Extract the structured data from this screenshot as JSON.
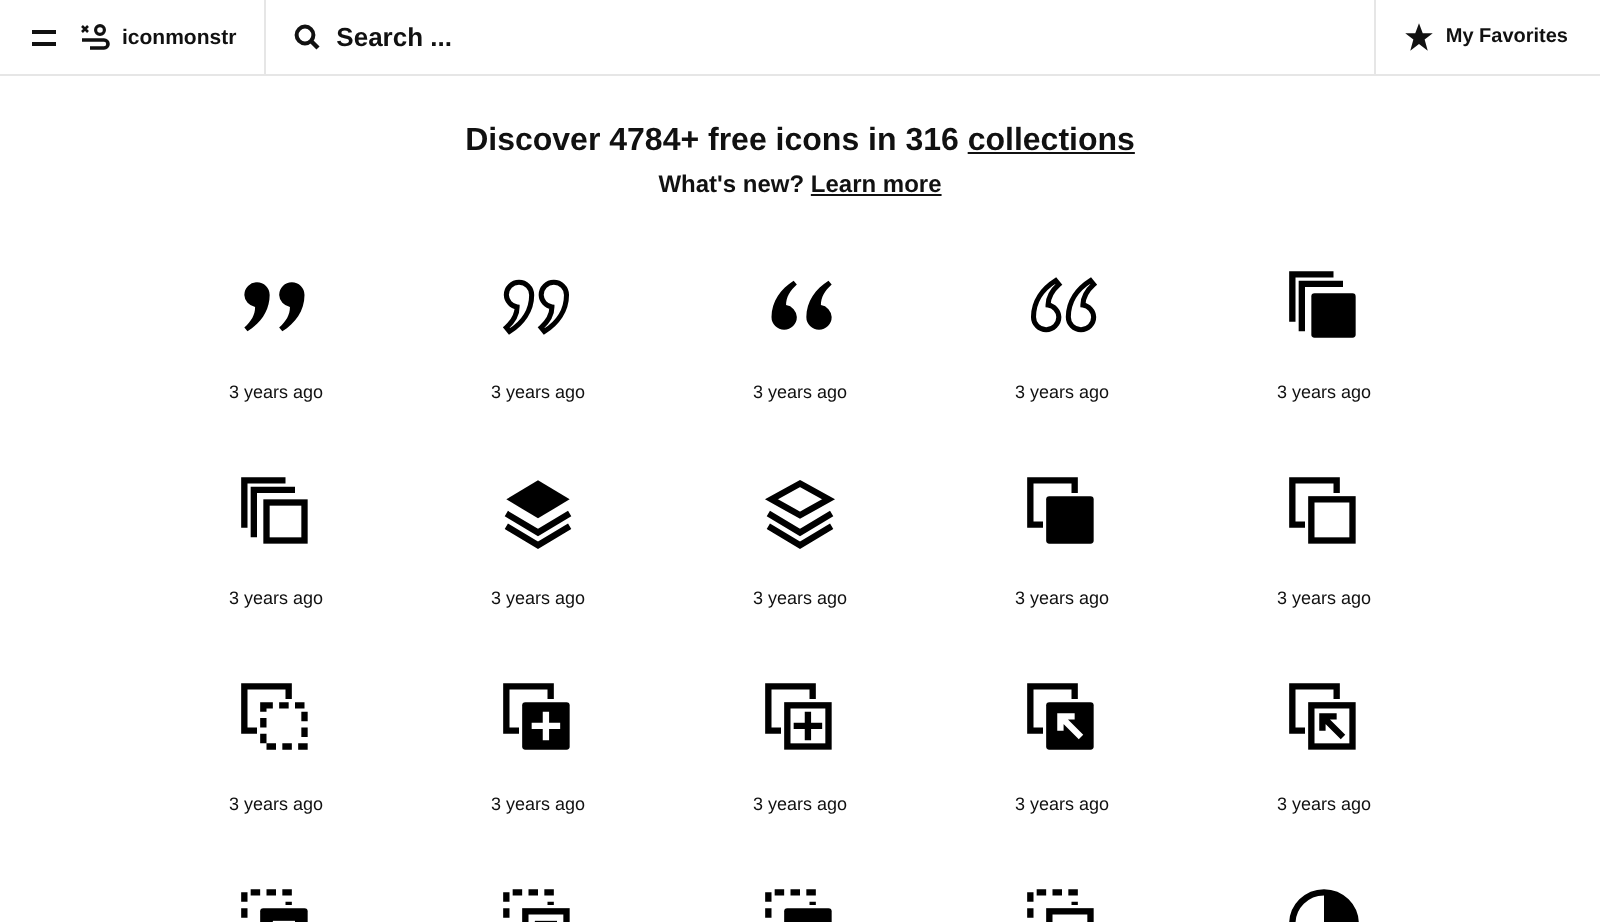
{
  "header": {
    "logo_text": "iconmonstr",
    "search": {
      "placeholder": "Search ..."
    },
    "favorites": "My Favorites"
  },
  "hero": {
    "title": "Discover 4784+ free icons in 316",
    "title_link": "collections",
    "subtitle": "What's new?",
    "subtitle_link": "Learn more"
  },
  "icons": [
    {
      "kind": "quote-close-filled",
      "time": "3 years ago"
    },
    {
      "kind": "quote-close-outline",
      "time": "3 years ago"
    },
    {
      "kind": "quote-open-filled",
      "time": "3 years ago"
    },
    {
      "kind": "quote-open-outline",
      "time": "3 years ago"
    },
    {
      "kind": "stack-filled",
      "time": "3 years ago"
    },
    {
      "kind": "stack-outline",
      "time": "3 years ago"
    },
    {
      "kind": "layers-filled",
      "time": "3 years ago"
    },
    {
      "kind": "layers-outline",
      "time": "3 years ago"
    },
    {
      "kind": "copy-filled",
      "time": "3 years ago"
    },
    {
      "kind": "copy-outline",
      "time": "3 years ago"
    },
    {
      "kind": "copy-dashed",
      "time": "3 years ago"
    },
    {
      "kind": "copy-plus-filled",
      "time": "3 years ago"
    },
    {
      "kind": "copy-plus-outline",
      "time": "3 years ago"
    },
    {
      "kind": "copy-arrow-filled",
      "time": "3 years ago"
    },
    {
      "kind": "copy-arrow-outline",
      "time": "3 years ago"
    },
    {
      "kind": "dashed-copy-filled"
    },
    {
      "kind": "dashed-copy-outline"
    },
    {
      "kind": "dashed-copy-solid"
    },
    {
      "kind": "dashed-copy-empty"
    },
    {
      "kind": "pie"
    }
  ]
}
